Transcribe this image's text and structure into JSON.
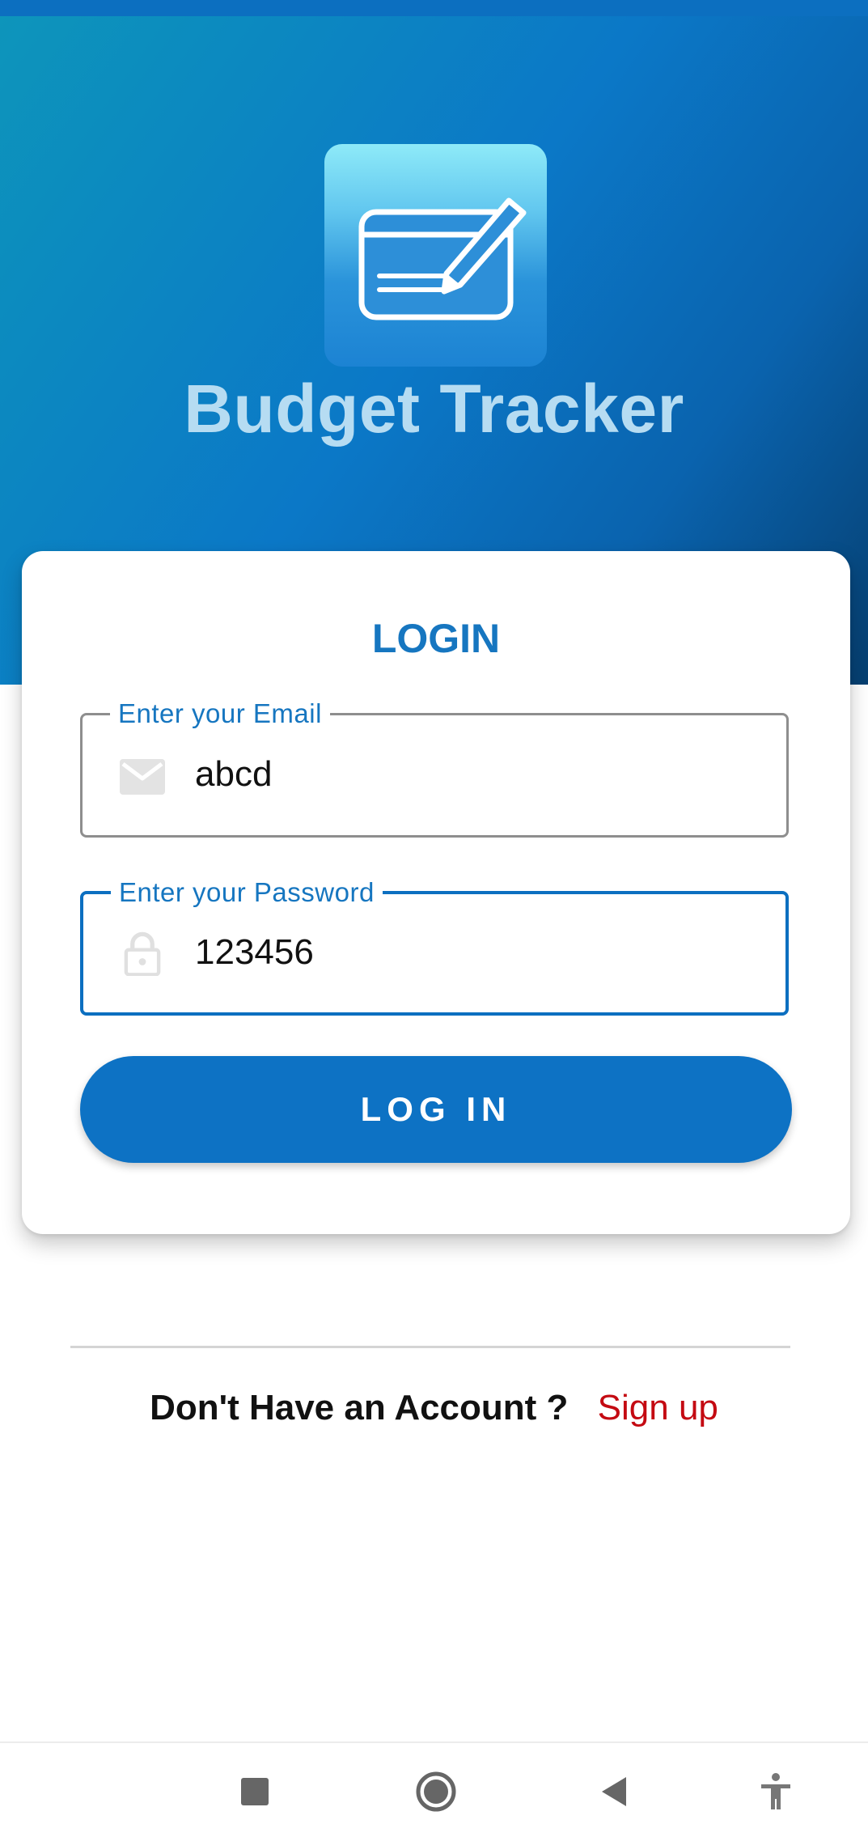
{
  "app": {
    "title": "Budget Tracker",
    "logo_icon": "card-pencil-icon"
  },
  "login_card": {
    "title": "LOGIN",
    "email": {
      "label": "Enter your Email",
      "value": "abcd",
      "icon": "mail-icon"
    },
    "password": {
      "label": "Enter your Password",
      "value": "123456",
      "icon": "lock-icon"
    },
    "submit_label": "LOG IN"
  },
  "signup": {
    "prompt": "Don't Have an Account ?",
    "link_label": "Sign up"
  },
  "nav_bar": {
    "buttons": [
      "recents-square-icon",
      "home-circle-icon",
      "back-triangle-icon",
      "accessibility-icon"
    ]
  },
  "colors": {
    "brand_blue": "#0d72c4",
    "signup_red": "#c40a12",
    "title_text": "#b6dcf2"
  }
}
